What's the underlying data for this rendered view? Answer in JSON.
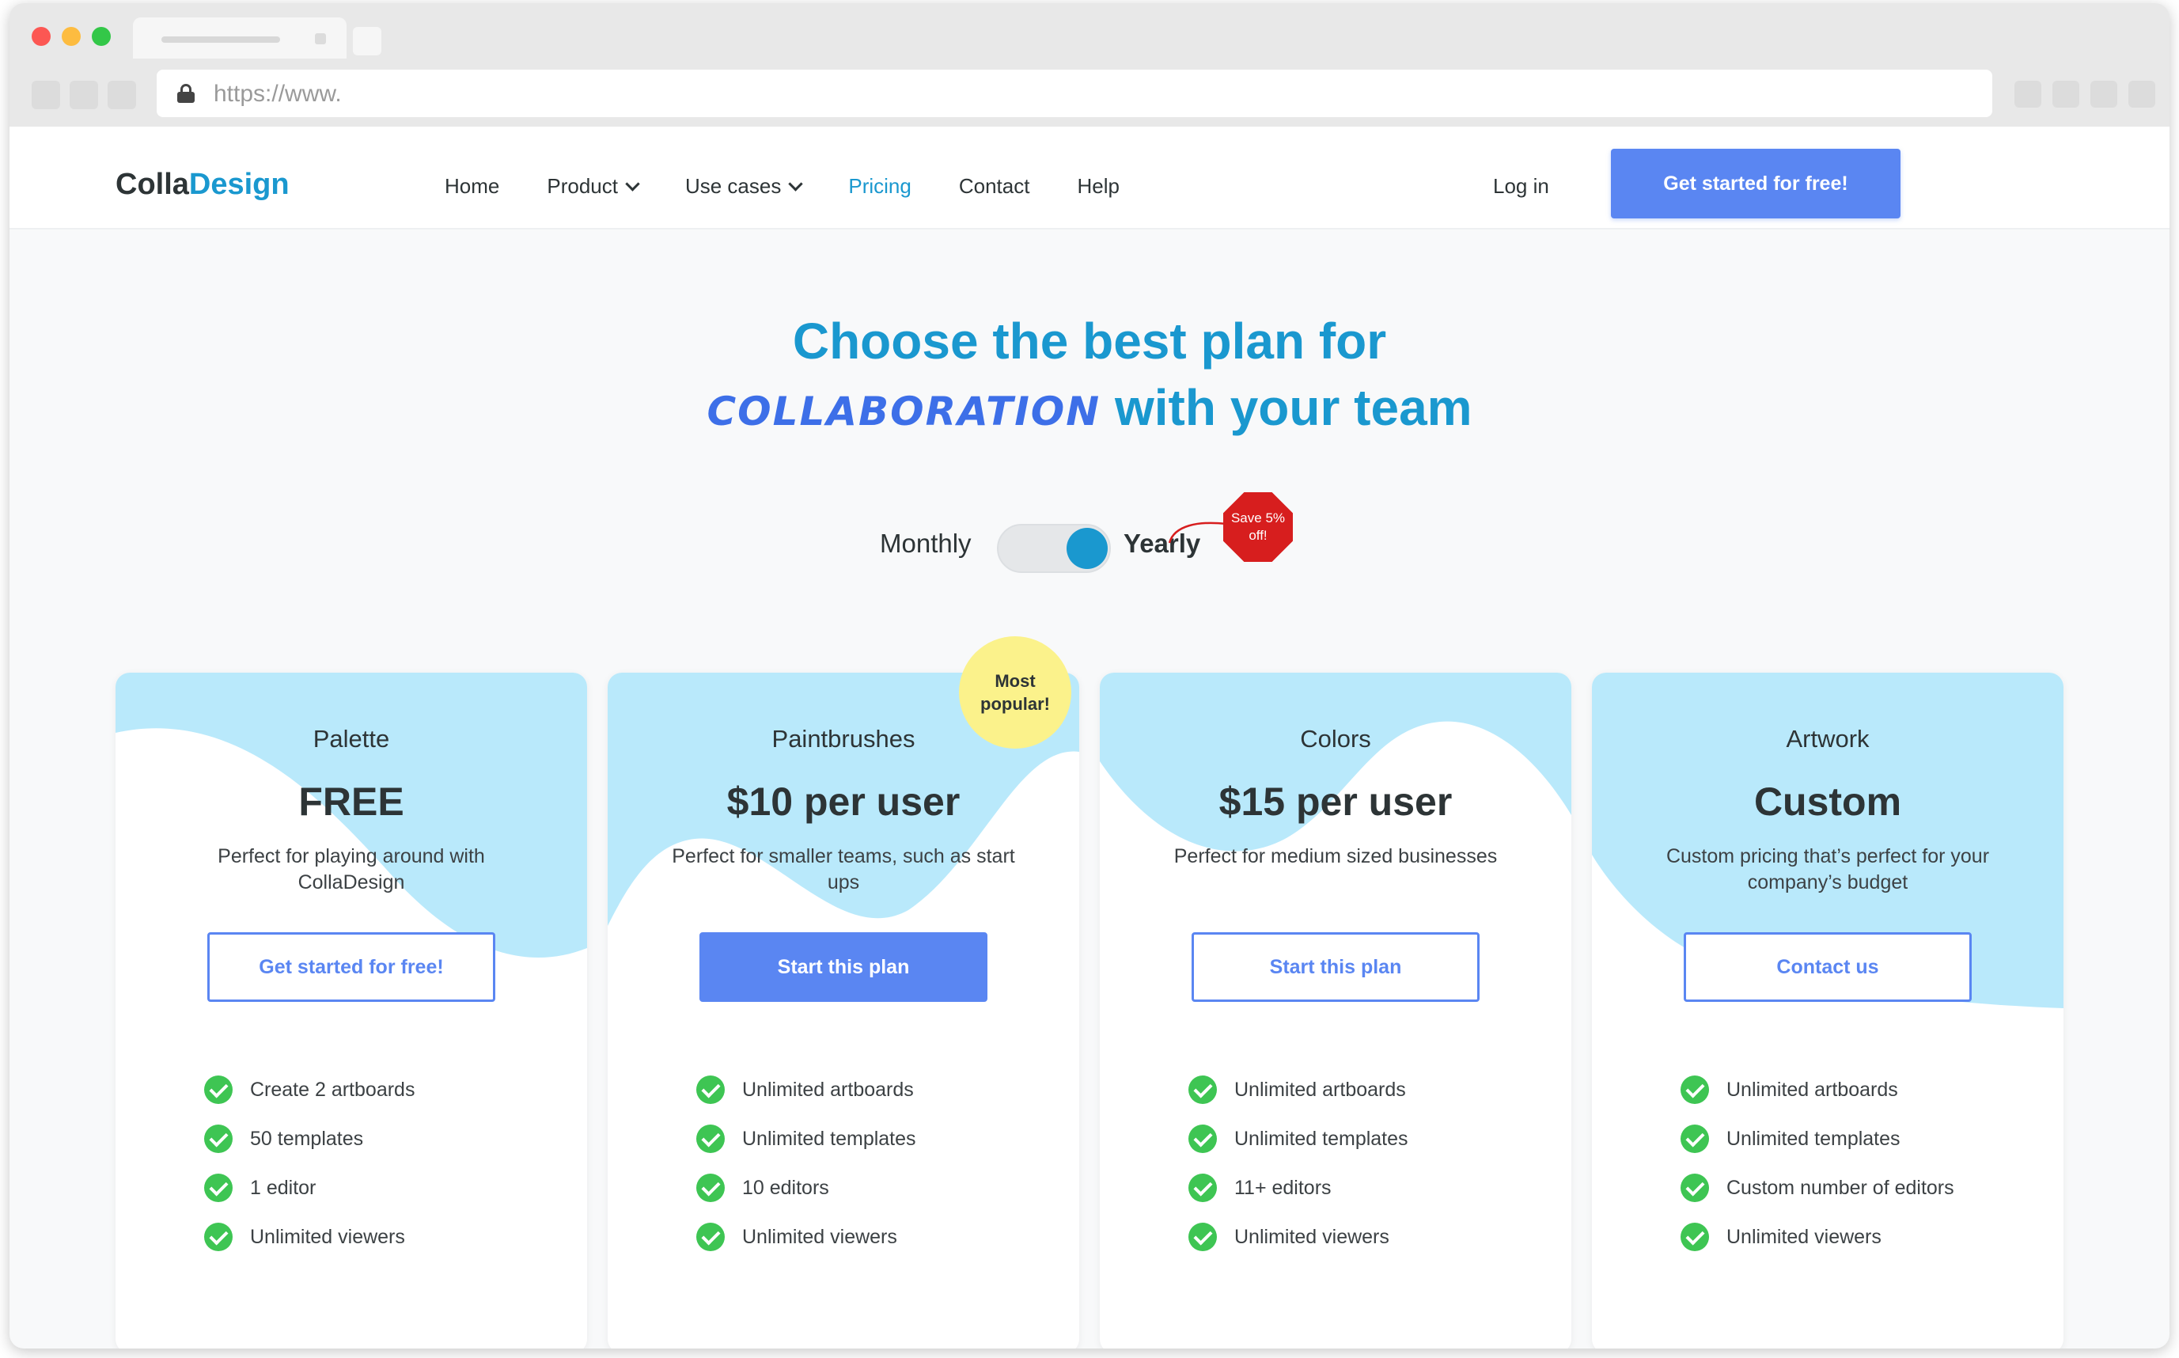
{
  "browser": {
    "url": "https://www."
  },
  "nav": {
    "logo_part1": "Colla",
    "logo_part2": "Design",
    "items": [
      {
        "label": "Home"
      },
      {
        "label": "Product"
      },
      {
        "label": "Use cases"
      },
      {
        "label": "Pricing"
      },
      {
        "label": "Contact"
      },
      {
        "label": "Help"
      }
    ],
    "login": "Log in",
    "cta": "Get started for free!"
  },
  "hero": {
    "line1": "Choose the best plan for",
    "line2_script": "COLLABORATION",
    "line2_rest": "with your team"
  },
  "billing": {
    "monthly": "Monthly",
    "yearly": "Yearly",
    "selected": "Yearly",
    "badge": "Save 5% off!"
  },
  "badge_popular": "Most popular!",
  "colors": {
    "accent": "#1a98cf",
    "button": "#5a86f2",
    "blob": "#b9e9fb",
    "check": "#3ec553",
    "save_badge": "#d71e1e",
    "popular_badge": "#fbf28b"
  },
  "plans": [
    {
      "name": "Palette",
      "price": "FREE",
      "desc": "Perfect for playing around with CollaDesign",
      "button": "Get started for free!",
      "features": [
        "Create 2 artboards",
        "50 templates",
        "1 editor",
        "Unlimited viewers"
      ]
    },
    {
      "name": "Paintbrushes",
      "price": "$10 per user",
      "desc": "Perfect for smaller teams, such as start ups",
      "button": "Start this plan",
      "features": [
        "Unlimited artboards",
        "Unlimited templates",
        "10 editors",
        "Unlimited viewers"
      ]
    },
    {
      "name": "Colors",
      "price": "$15 per user",
      "desc": "Perfect for medium sized businesses",
      "button": "Start this plan",
      "features": [
        "Unlimited artboards",
        "Unlimited templates",
        "11+ editors",
        "Unlimited viewers"
      ]
    },
    {
      "name": "Artwork",
      "price": "Custom",
      "desc": "Custom pricing that’s perfect for your company’s budget",
      "button": "Contact us",
      "features": [
        "Unlimited artboards",
        "Unlimited templates",
        "Custom number of editors",
        "Unlimited viewers"
      ]
    }
  ]
}
